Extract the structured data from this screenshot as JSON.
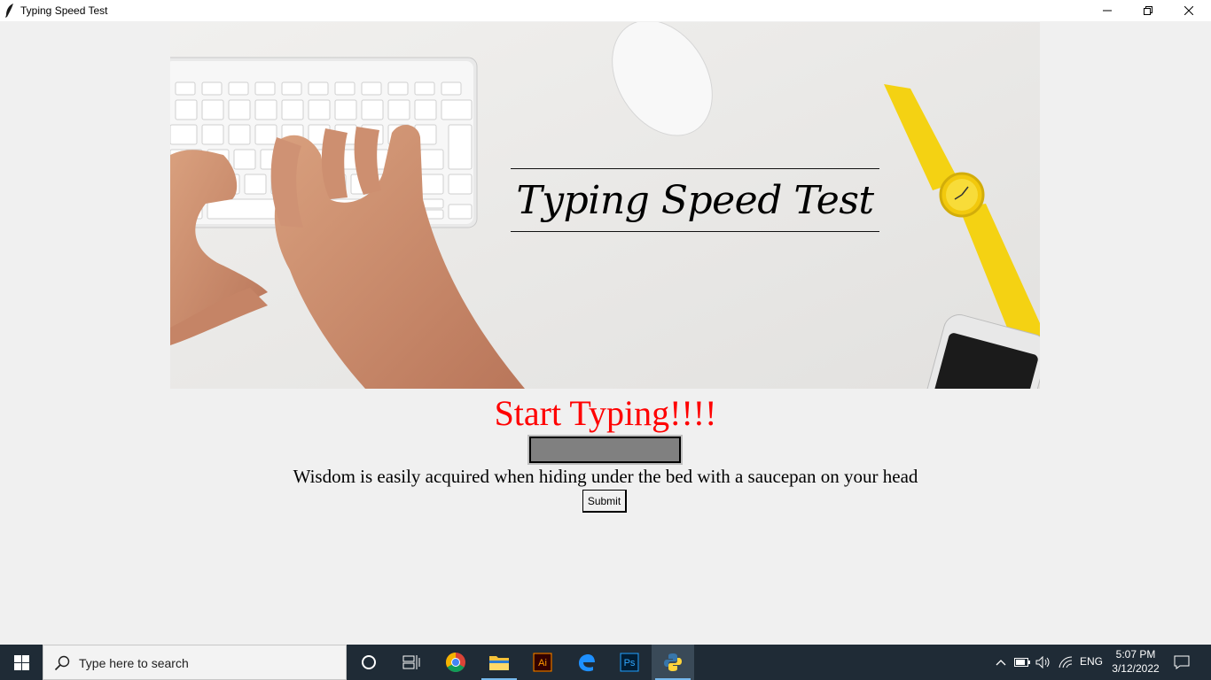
{
  "window": {
    "title": "Typing Speed Test",
    "controls": [
      "minimize",
      "maximize",
      "close"
    ]
  },
  "banner": {
    "title": "Typing Speed Test"
  },
  "main": {
    "heading": "Start Typing!!!!",
    "input_value": "",
    "sentence": "Wisdom is easily acquired when hiding under the bed with a saucepan on your head",
    "submit_label": "Submit"
  },
  "taskbar": {
    "search_placeholder": "Type here to search",
    "apps": [
      "cortana-icon",
      "task-view-icon",
      "chrome-icon",
      "file-explorer-icon",
      "illustrator-icon",
      "edge-icon",
      "photoshop-icon",
      "python-icon"
    ],
    "illustrator_label": "Ai",
    "photoshop_label": "Ps",
    "language": "ENG",
    "time": "5:07 PM",
    "date": "3/12/2022"
  },
  "colors": {
    "heading": "#ff0000",
    "taskbar": "#1f2b36",
    "background": "#f0f0f0"
  }
}
